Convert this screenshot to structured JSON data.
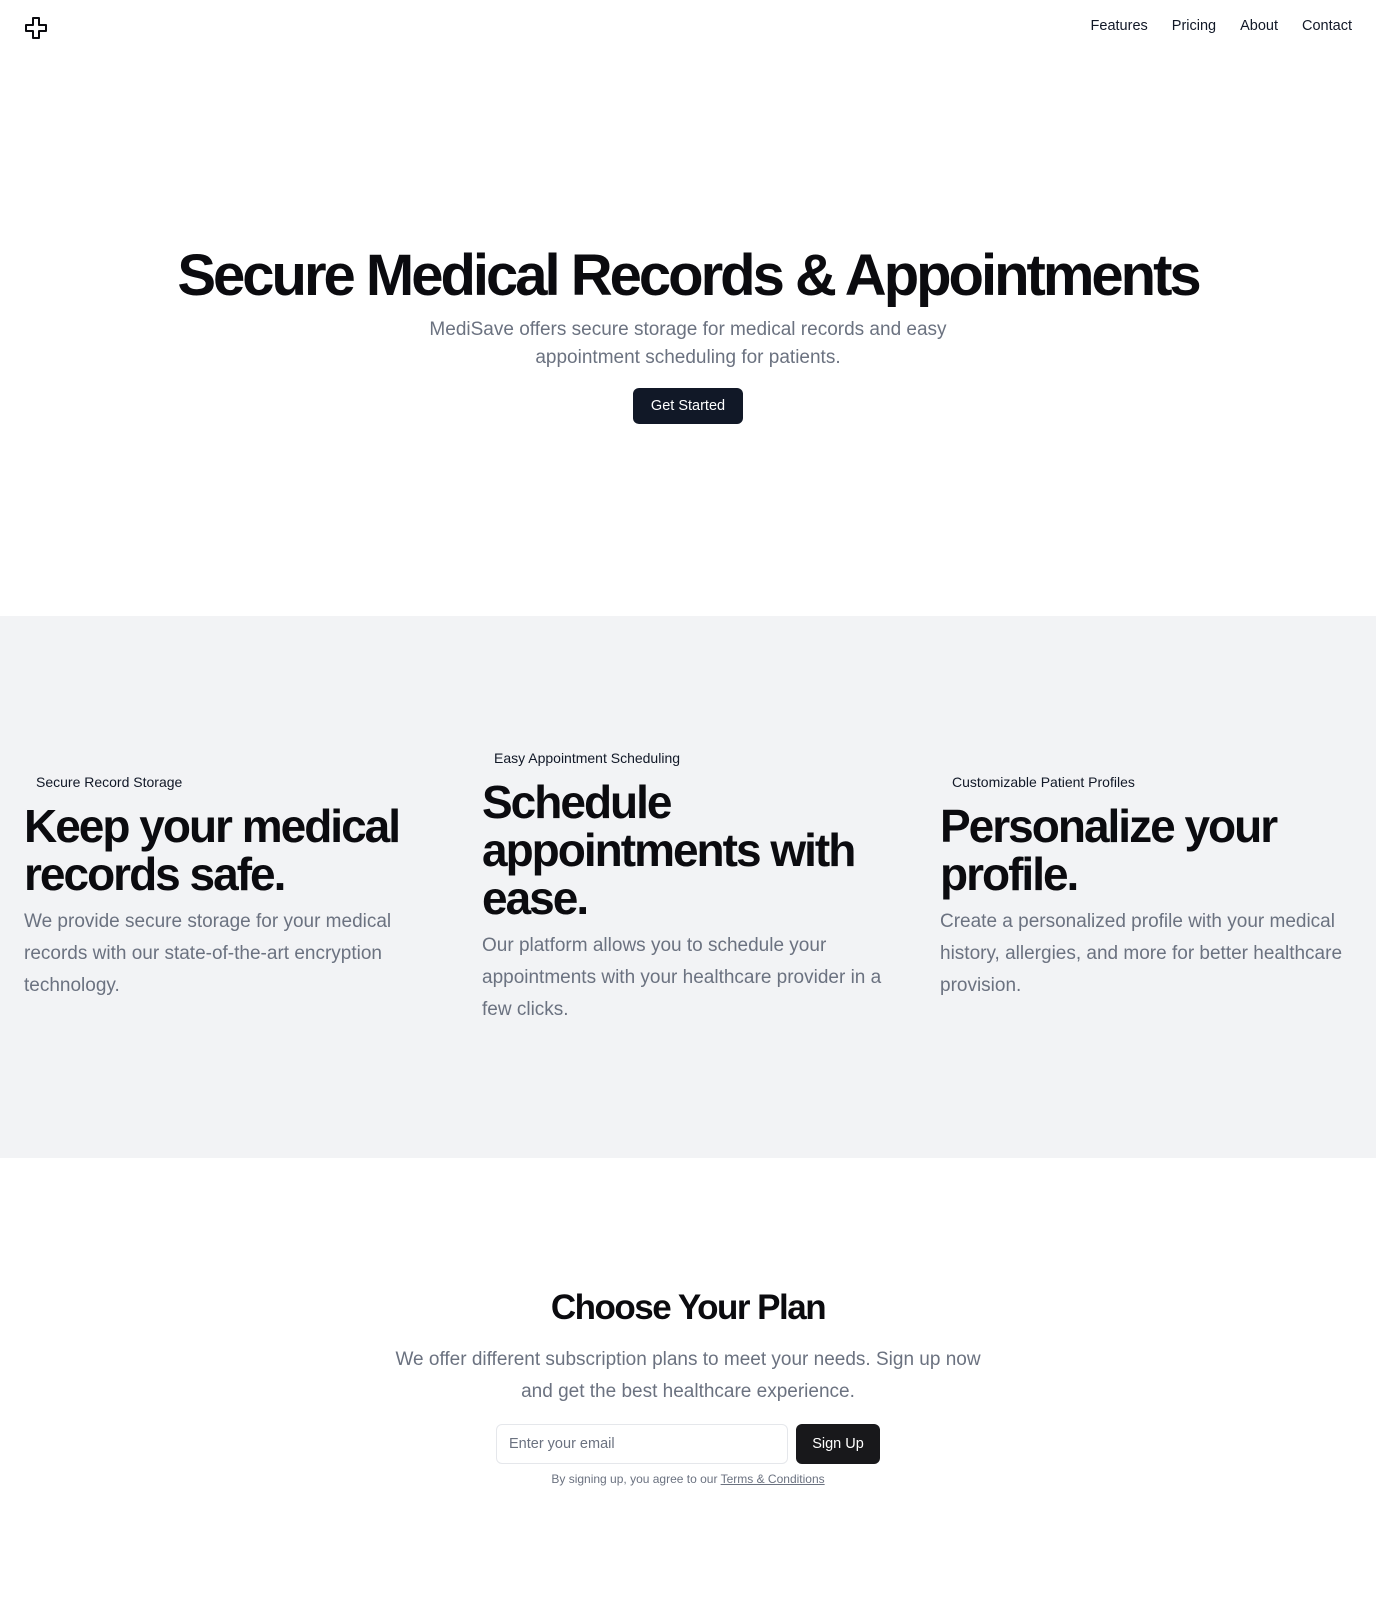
{
  "header": {
    "logo_icon": "plus-cross-icon",
    "nav": [
      "Features",
      "Pricing",
      "About",
      "Contact"
    ]
  },
  "hero": {
    "title": "Secure Medical Records & Appointments",
    "subtitle": "MediSave offers secure storage for medical records and easy appointment scheduling for patients.",
    "cta_label": "Get Started"
  },
  "features": [
    {
      "tag": "Secure Record Storage",
      "heading": "Keep your medical records safe.",
      "text": "We provide secure storage for your medical records with our state-of-the-art encryption technology."
    },
    {
      "tag": "Easy Appointment Scheduling",
      "heading": "Schedule appointments with ease.",
      "text": "Our platform allows you to schedule your appointments with your healthcare provider in a few clicks."
    },
    {
      "tag": "Customizable Patient Profiles",
      "heading": "Personalize your profile.",
      "text": "Create a personalized profile with your medical history, allergies, and more for better healthcare provision."
    }
  ],
  "plan": {
    "title": "Choose Your Plan",
    "description": "We offer different subscription plans to meet your needs. Sign up now and get the best healthcare experience.",
    "email_placeholder": "Enter your email",
    "signup_label": "Sign Up",
    "terms_prefix": "By signing up, you agree to our",
    "terms_link": "Terms & Conditions"
  },
  "colors": {
    "primary_button": "#111827",
    "features_background": "#f2f3f5",
    "muted_text": "#6b7280"
  }
}
